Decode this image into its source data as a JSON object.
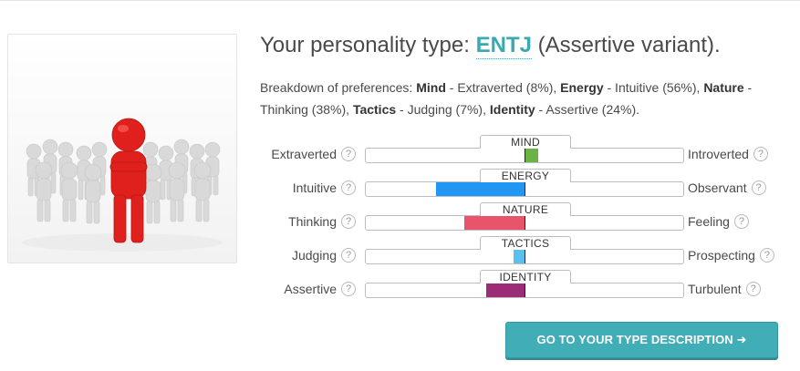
{
  "title": {
    "prefix": "Your personality type: ",
    "type": "ENTJ",
    "suffix": " (Assertive variant)."
  },
  "breakdown": {
    "intro": "Breakdown of preferences: ",
    "items": [
      {
        "name": "Mind",
        "text": " - Extraverted (8%), "
      },
      {
        "name": "Energy",
        "text": " - Intuitive (56%), "
      },
      {
        "name": "Nature",
        "text": " - Thinking (38%), "
      },
      {
        "name": "Tactics",
        "text": " - Judging (7%), "
      },
      {
        "name": "Identity",
        "text": " - Assertive (24%)."
      }
    ]
  },
  "help_glyph": "?",
  "scales": [
    {
      "label": "MIND",
      "left": "Extraverted",
      "right": "Introverted",
      "side": "right",
      "percent": 8,
      "color": "#6ab344"
    },
    {
      "label": "ENERGY",
      "left": "Intuitive",
      "right": "Observant",
      "side": "left",
      "percent": 56,
      "color": "#2196f3"
    },
    {
      "label": "NATURE",
      "left": "Thinking",
      "right": "Feeling",
      "side": "left",
      "percent": 38,
      "color": "#e8556a"
    },
    {
      "label": "TACTICS",
      "left": "Judging",
      "right": "Prospecting",
      "side": "left",
      "percent": 7,
      "color": "#5bc0eb"
    },
    {
      "label": "IDENTITY",
      "left": "Assertive",
      "right": "Turbulent",
      "side": "left",
      "percent": 24,
      "color": "#9b2c75"
    }
  ],
  "cta": {
    "label": "GO TO YOUR TYPE DESCRIPTION ➜"
  }
}
